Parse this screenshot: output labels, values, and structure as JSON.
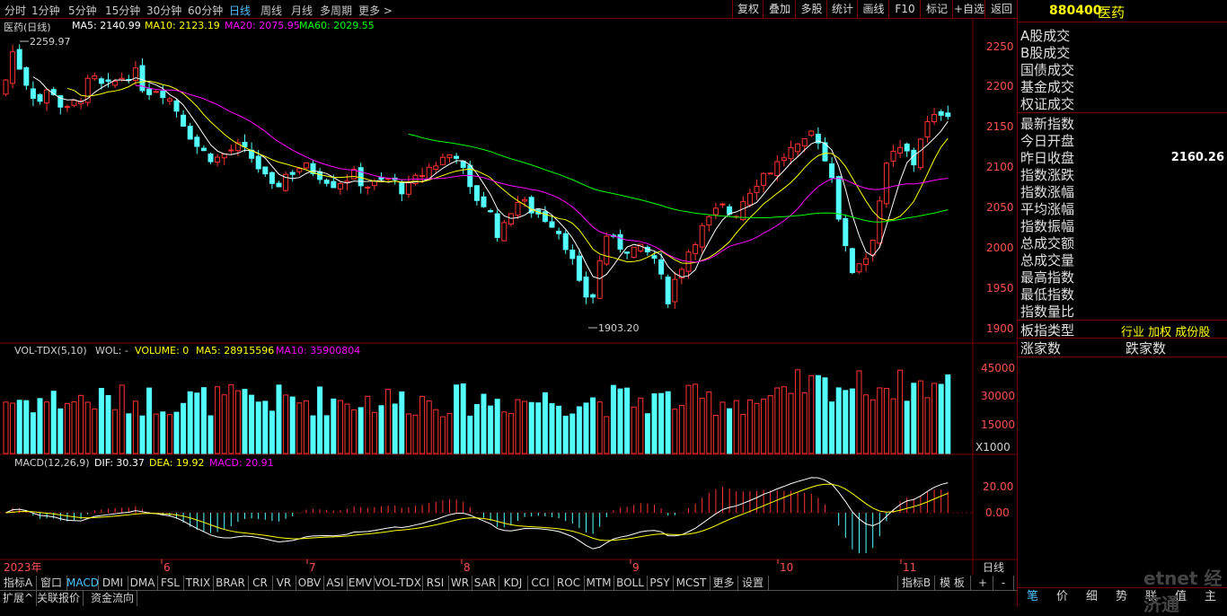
{
  "toolbar": {
    "periods": [
      "分时",
      "1分钟",
      "5分钟",
      "15分钟",
      "30分钟",
      "60分钟",
      "日线",
      "周线",
      "月线",
      "多周期",
      "更多 >"
    ],
    "active_period": "日线",
    "right_buttons": [
      "复权",
      "叠加",
      "多股",
      "统计",
      "画线",
      "F10",
      "标记",
      "+自选",
      "返回"
    ]
  },
  "main": {
    "title": "医药(日线)",
    "ma5": "MA5: 2140.99",
    "ma10": "MA10: 2123.19",
    "ma20": "MA20: 2075.95",
    "ma60": "MA60: 2029.55",
    "high_label": "2259.97",
    "low_label": "1903.20",
    "y_ticks": [
      "2250",
      "2200",
      "2150",
      "2100",
      "2050",
      "2000",
      "1950",
      "1900"
    ]
  },
  "volume": {
    "title": "VOL-TDX(5,10)",
    "wol": "WOL: -",
    "volume": "VOLUME: 0",
    "ma5": "MA5: 28915596",
    "ma10": "MA10: 35900804",
    "y_ticks": [
      "45000",
      "30000",
      "15000"
    ],
    "unit": "X1000"
  },
  "macd": {
    "title": "MACD(12,26,9)",
    "dif": "DIF: 30.37",
    "dea": "DEA: 19.92",
    "macd": "MACD: 20.91",
    "y_ticks": [
      "20.00",
      "0.00"
    ]
  },
  "x_axis": {
    "labels": [
      "2023年",
      "6",
      "7",
      "8",
      "9",
      "10",
      "11"
    ],
    "right_label": "日线"
  },
  "indicator_tabs": [
    "指标A",
    "窗口",
    "MACD",
    "DMI",
    "DMA",
    "FSL",
    "TRIX",
    "BRAR",
    "CR",
    "VR",
    "OBV",
    "ASI",
    "EMV",
    "VOL-TDX",
    "RSI",
    "WR",
    "SAR",
    "KDJ",
    "CCI",
    "ROC",
    "MTM",
    "BOLL",
    "PSY",
    "MCST",
    "更多",
    "设置"
  ],
  "active_indicator": "MACD",
  "indicator_right": [
    "指标B",
    "模 板",
    "+",
    "-"
  ],
  "bottom_tabs": [
    "扩展^",
    "关联报价",
    "资金流向"
  ],
  "right_panel": {
    "code": "880400",
    "name": "医药",
    "trade_items": [
      "A股成交",
      "B股成交",
      "国债成交",
      "基金成交",
      "权证成交"
    ],
    "stats": [
      "最新指数",
      "今日开盘",
      "昨日收盘",
      "指数涨跌",
      "指数涨幅",
      "平均涨幅",
      "指数振幅",
      "总成交额",
      "总成交量",
      "最高指数",
      "最低指数",
      "指数量比"
    ],
    "prev_close": "2160.26",
    "type_label": "板指类型",
    "type_value": "行业 加权 成份股",
    "up_label": "涨家数",
    "down_label": "跌家数",
    "bottom_tabs": [
      "笔",
      "价",
      "细",
      "势",
      "联",
      "值",
      "主"
    ]
  },
  "watermark": "etnet 经济通",
  "colors": {
    "up": "#ff3232",
    "down": "#54ffff",
    "ma5": "#ffffff",
    "ma10": "#ffff00",
    "ma20": "#ff00ff",
    "ma60": "#00ff00",
    "border": "#7a0000",
    "active": "#4fc3ff"
  }
}
